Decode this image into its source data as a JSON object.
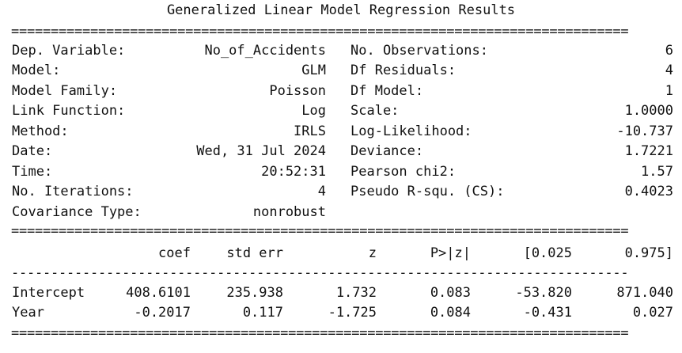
{
  "title": "Generalized Linear Model Regression Results",
  "summary_rows": [
    {
      "left_label": "Dep. Variable:",
      "left_value": "No_of_Accidents",
      "right_label": "No. Observations:",
      "right_value": "6"
    },
    {
      "left_label": "Model:",
      "left_value": "GLM",
      "right_label": "Df Residuals:",
      "right_value": "4"
    },
    {
      "left_label": "Model Family:",
      "left_value": "Poisson",
      "right_label": "Df Model:",
      "right_value": "1"
    },
    {
      "left_label": "Link Function:",
      "left_value": "Log",
      "right_label": "Scale:",
      "right_value": "1.0000"
    },
    {
      "left_label": "Method:",
      "left_value": "IRLS",
      "right_label": "Log-Likelihood:",
      "right_value": "-10.737"
    },
    {
      "left_label": "Date:",
      "left_value": "Wed, 31 Jul 2024",
      "right_label": "Deviance:",
      "right_value": "1.7221"
    },
    {
      "left_label": "Time:",
      "left_value": "20:52:31",
      "right_label": "Pearson chi2:",
      "right_value": "1.57"
    },
    {
      "left_label": "No. Iterations:",
      "left_value": "4",
      "right_label": "Pseudo R-squ. (CS):",
      "right_value": "0.4023"
    },
    {
      "left_label": "Covariance Type:",
      "left_value": "nonrobust",
      "right_label": "",
      "right_value": ""
    }
  ],
  "coef_header": [
    "coef",
    "std err",
    "z",
    "P>|z|",
    "[0.025",
    "0.975]"
  ],
  "coef_rows": [
    {
      "name": "Intercept",
      "values": [
        "408.6101",
        "235.938",
        "1.732",
        "0.083",
        "-53.820",
        "871.040"
      ]
    },
    {
      "name": "Year",
      "values": [
        "-0.2017",
        "0.117",
        "-1.725",
        "0.084",
        "-0.431",
        "0.027"
      ]
    }
  ],
  "rules": {
    "double": "==============================================================================",
    "single": "------------------------------------------------------------------------------"
  }
}
